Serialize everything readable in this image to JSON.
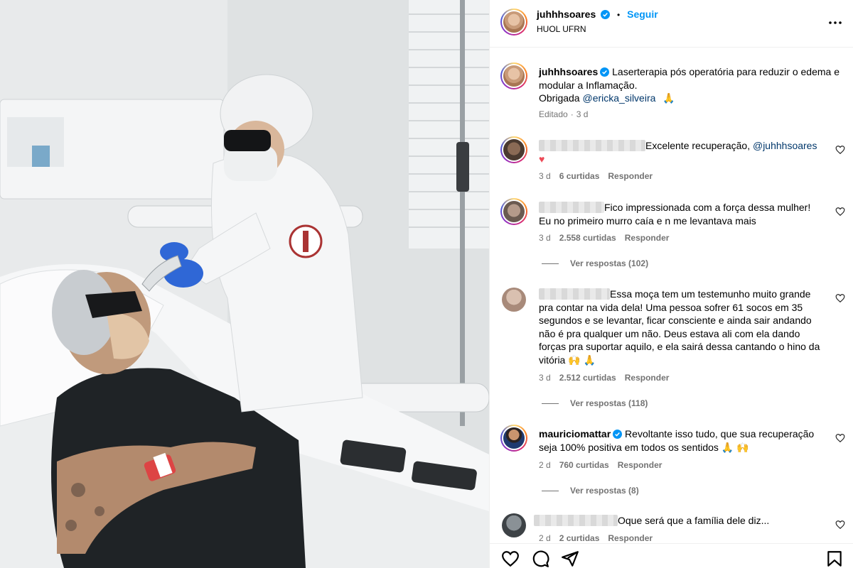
{
  "post": {
    "author": "juhhhsoares",
    "follow_label": "Seguir",
    "separator": "•",
    "location": "HUOL UFRN"
  },
  "caption": {
    "author": "juhhhsoares",
    "text": "Laserterapia pós operatória para reduzir o edema e modular a Inflamação.",
    "thanks": "Obrigada",
    "mention": "@ericka_silveira",
    "emoji": "🙏",
    "edited": "Editado",
    "time": "3 d"
  },
  "comments": [
    {
      "text": "Excelente recuperação,",
      "mention": "@juhhhsoares",
      "emoji": "♥",
      "time": "3 d",
      "likes": "6 curtidas",
      "reply": "Responder"
    },
    {
      "text": "Fico impressionada com a força dessa mulher! Eu no primeiro murro caía e n me levantava mais",
      "time": "3 d",
      "likes": "2.558 curtidas",
      "reply": "Responder",
      "replies": "Ver respostas (102)"
    },
    {
      "text": "Essa moça tem um testemunho muito grande pra contar na vida dela! Uma pessoa sofrer 61 socos em 35 segundos e se levantar, ficar consciente e ainda sair andando não é pra qualquer um não. Deus estava ali com ela dando forças pra suportar aquilo, e ela sairá dessa cantando o hino da vitória",
      "emoji": "🙌 🙏",
      "time": "3 d",
      "likes": "2.512 curtidas",
      "reply": "Responder",
      "replies": "Ver respostas (118)"
    },
    {
      "author": "mauriciomattar",
      "text": "Revoltante isso tudo, que sua recuperação seja 100% positiva em todos os sentidos",
      "emoji": "🙏 🙌",
      "time": "2 d",
      "likes": "760 curtidas",
      "reply": "Responder",
      "replies": "Ver respostas (8)"
    },
    {
      "text": "Oque será que a família dele diz...",
      "time": "2 d",
      "likes": "2 curtidas",
      "reply": "Responder"
    }
  ],
  "colors": {
    "link": "#00376b",
    "follow": "#0095f6",
    "verified": "#0095f6",
    "muted": "#737373"
  },
  "icons": [
    "more-icon",
    "verified-icon",
    "heart-icon",
    "comment-icon",
    "share-icon",
    "bookmark-icon"
  ]
}
